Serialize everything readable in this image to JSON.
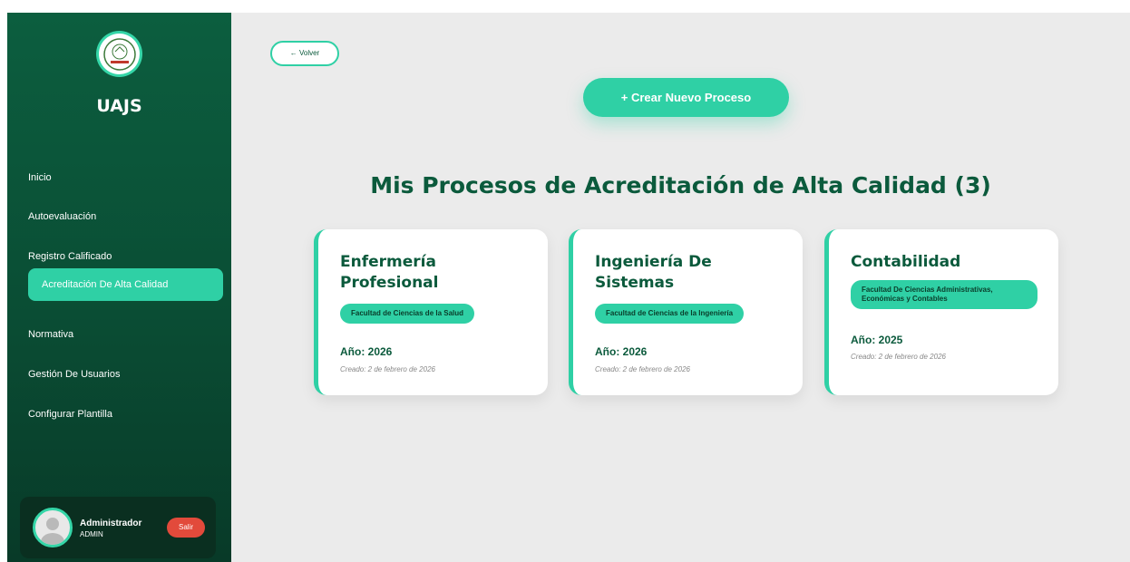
{
  "brand": "UAJS",
  "colors": {
    "primary": "#0b5a3c",
    "accent": "#2fd0a5",
    "danger": "#e24a3b",
    "background": "#ebebeb"
  },
  "nav": {
    "items": [
      {
        "label": "Inicio"
      },
      {
        "label": "Autoevaluación"
      },
      {
        "label": "Registro Calificado"
      },
      {
        "label": "Acreditación De Alta Calidad",
        "active": true
      },
      {
        "label": "Normativa"
      },
      {
        "label": "Gestión De Usuarios"
      },
      {
        "label": "Configurar Plantilla"
      }
    ]
  },
  "user": {
    "name": "Administrador",
    "role": "ADMIN",
    "logout_label": "Salir",
    "avatar_icon": "user-avatar-icon"
  },
  "main": {
    "back_label": "← Volver",
    "create_label": "+ Crear Nuevo Proceso",
    "title": "Mis Procesos de Acreditación de Alta Calidad (3)"
  },
  "cards": [
    {
      "title": "Enfermería Profesional",
      "faculty": "Facultad de Ciencias de la Salud",
      "year": "Año: 2026",
      "created": "Creado: 2 de febrero de 2026"
    },
    {
      "title": "Ingeniería De Sistemas",
      "faculty": "Facultad de Ciencias de la Ingeniería",
      "year": "Año: 2026",
      "created": "Creado: 2 de febrero de 2026"
    },
    {
      "title": "Contabilidad",
      "faculty": "Facultad De Ciencias Administrativas, Económicas y Contables",
      "year": "Año: 2025",
      "created": "Creado: 2 de febrero de 2026"
    }
  ]
}
